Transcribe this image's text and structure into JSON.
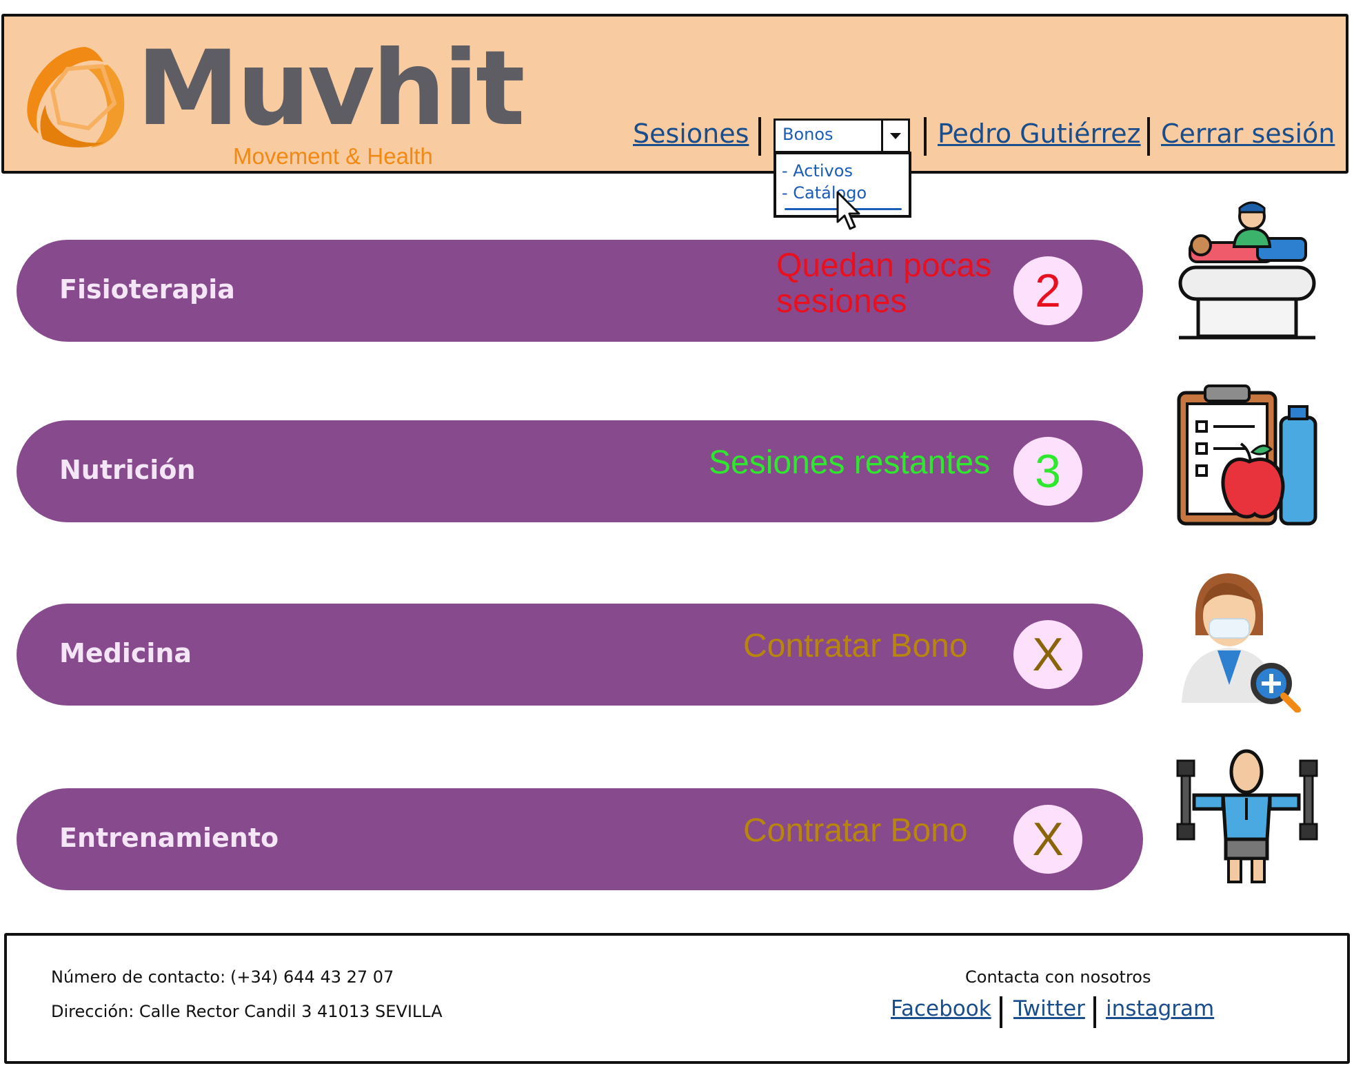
{
  "brand": {
    "name": "Muvhit",
    "tagline": "Movement & Health",
    "colors": {
      "orange": "#f08a14",
      "gray": "#5d5d63",
      "header_bg": "#f8cba0"
    }
  },
  "nav": {
    "sessions_label": "Sesiones",
    "bonos_select": {
      "value": "Bonos",
      "options": [
        "- Activos",
        "- Catálogo"
      ]
    },
    "user_label": "Pedro Gutiérrez",
    "logout_label": "Cerrar sesión"
  },
  "services": [
    {
      "name": "Fisioterapia",
      "status": "Quedan pocas sesiones",
      "status_line1": "Quedan pocas",
      "status_line2": "sesiones",
      "count": "2",
      "status_color": "#e8101e",
      "icon": "physiotherapy-icon"
    },
    {
      "name": "Nutrición",
      "status": "Sesiones restantes",
      "count": "3",
      "status_color": "#2ee82e",
      "icon": "nutrition-clipboard-icon"
    },
    {
      "name": "Medicina",
      "status": "Contratar Bono",
      "count": "X",
      "status_color": "#b8860b",
      "icon": "doctor-icon"
    },
    {
      "name": "Entrenamiento",
      "status": "Contratar Bono",
      "count": "X",
      "status_color": "#b8860b",
      "icon": "training-dumbbells-icon"
    }
  ],
  "footer": {
    "phone_label": "Número de contacto:",
    "phone_value": "(+34) 644 43 27 07",
    "address": "Dirección: Calle Rector Candil 3 41013 SEVILLA",
    "contact_title": "Contacta con nosotros",
    "social": [
      "Facebook",
      "Twitter",
      "instagram"
    ]
  }
}
